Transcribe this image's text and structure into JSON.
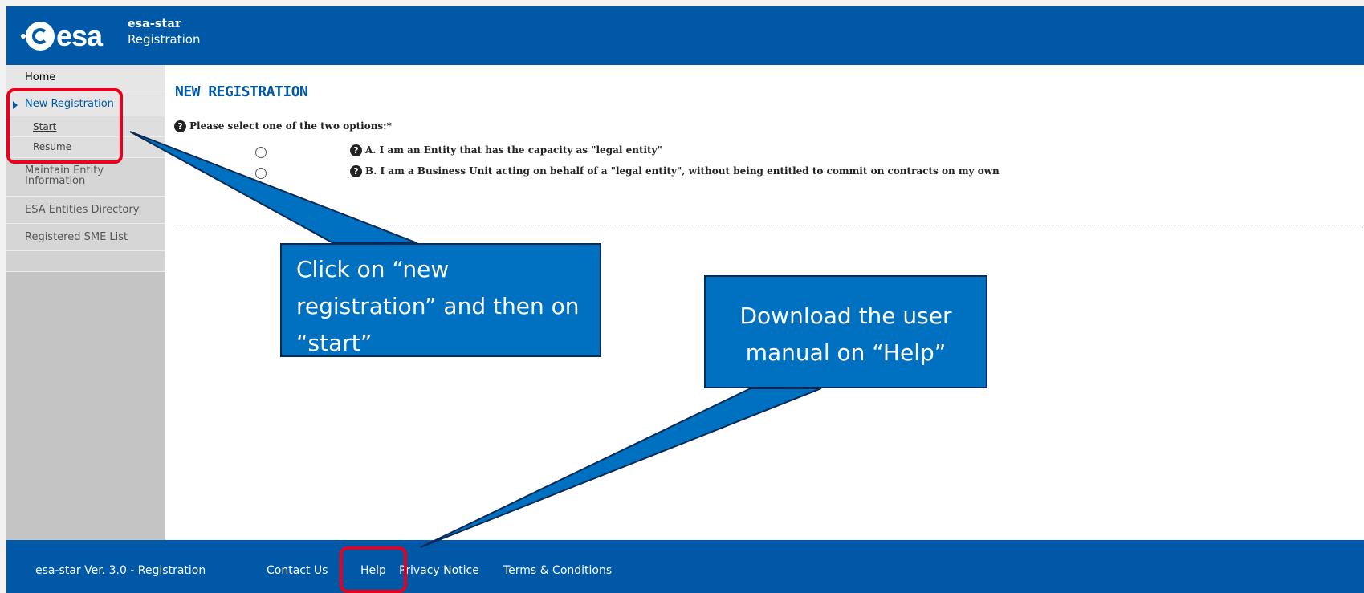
{
  "header": {
    "logo_text": "esa",
    "app_name": "esa-star",
    "subtitle": "Registration"
  },
  "sidebar": {
    "items": [
      {
        "label": "Home"
      },
      {
        "label": "New Registration"
      },
      {
        "label": "Start"
      },
      {
        "label": "Resume"
      },
      {
        "label": "Maintain Entity\nInformation"
      },
      {
        "label": "ESA Entities Directory"
      },
      {
        "label": "Registered SME List"
      }
    ]
  },
  "main": {
    "title": "NEW REGISTRATION",
    "question": "Please select one of the two options:*",
    "options": [
      {
        "label": "A. I am an Entity that has the capacity as \"legal entity\""
      },
      {
        "label": "B. I am a Business Unit acting on behalf of a \"legal entity\", without being entitled to commit on contracts on my own"
      }
    ]
  },
  "footer": {
    "version": "esa-star Ver. 3.0 - Registration",
    "contact": "Contact Us",
    "help": "Help",
    "privacy": "Privacy Notice",
    "terms": "Terms & Conditions"
  },
  "annotations": {
    "callout_1": "Click on “new registration” and then on “start”",
    "callout_2": "Download the user manual on “Help”"
  },
  "colors": {
    "brand_blue": "#0058a6",
    "callout_blue": "#0070c0",
    "highlight_red": "#e8001c"
  }
}
